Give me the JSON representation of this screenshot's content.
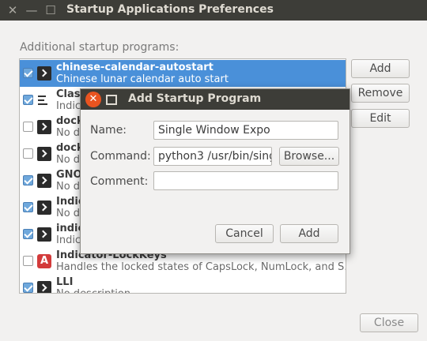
{
  "window": {
    "title": "Startup Applications Preferences",
    "close_glyph": "✕",
    "minimize_glyph": "—",
    "maximize_glyph": "☐"
  },
  "main": {
    "section_label": "Additional startup programs:",
    "buttons": {
      "add": "Add",
      "remove": "Remove",
      "edit": "Edit",
      "close": "Close"
    },
    "programs": [
      {
        "name": "chinese-calendar-autostart",
        "description": "Chinese lunar calendar auto start",
        "checked": true,
        "icon": "terminal-icon",
        "selected": true
      },
      {
        "name": "Class",
        "description": "Indic",
        "checked": true,
        "icon": "list-icon",
        "selected": false
      },
      {
        "name": "dock",
        "description": "No de",
        "checked": false,
        "icon": "terminal-icon",
        "selected": false
      },
      {
        "name": "dock",
        "description": "No de",
        "checked": false,
        "icon": "terminal-icon",
        "selected": false
      },
      {
        "name": "GNO",
        "description": "No de",
        "checked": true,
        "icon": "terminal-icon",
        "selected": false
      },
      {
        "name": "Indic",
        "description": "No de",
        "checked": true,
        "icon": "terminal-icon",
        "selected": false
      },
      {
        "name": "indic",
        "description": "Indica",
        "checked": true,
        "icon": "terminal-icon",
        "selected": false
      },
      {
        "name": "Indicator-LockKeys",
        "description": "Handles the locked states of CapsLock, NumLock, and S…",
        "checked": false,
        "icon": "red-a-icon",
        "icon_letter": "A",
        "selected": false
      },
      {
        "name": "LLI",
        "description": "No description",
        "checked": true,
        "icon": "terminal-icon",
        "selected": false
      }
    ]
  },
  "dialog": {
    "title": "Add Startup Program",
    "name_label": "Name:",
    "name_value": "Single Window Expo",
    "command_label": "Command:",
    "command_value": "python3 /usr/bin/singl",
    "browse_label": "Browse...",
    "comment_label": "Comment:",
    "comment_value": "",
    "cancel_label": "Cancel",
    "add_label": "Add"
  }
}
